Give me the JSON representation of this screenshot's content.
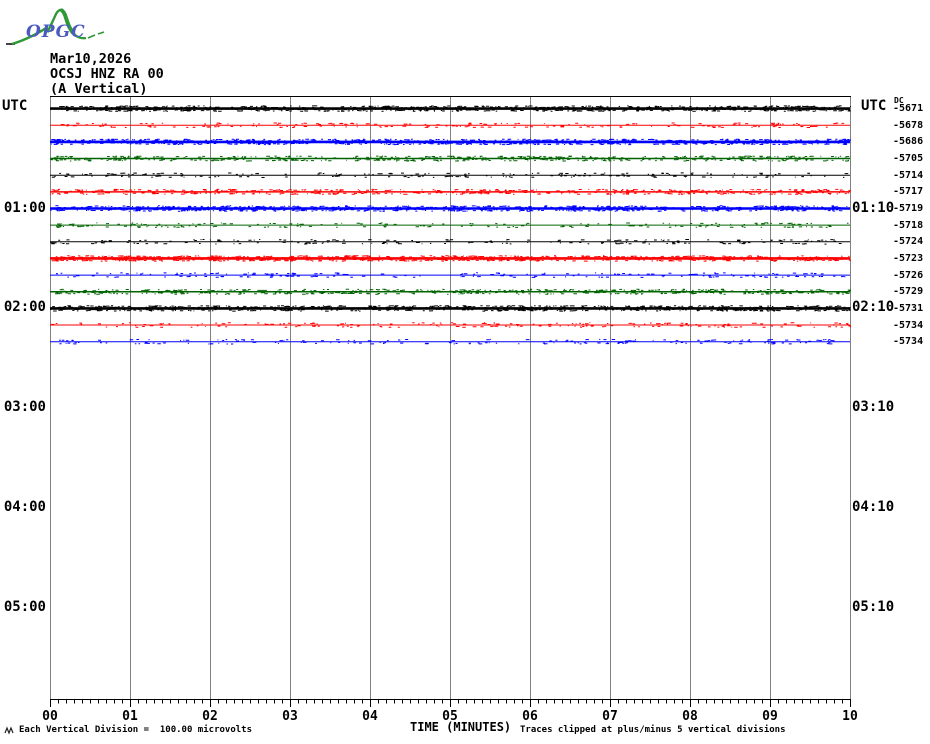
{
  "logo": {
    "text": "OPGC"
  },
  "header": {
    "date": "Mar10,2026",
    "station": "OCSJ HNZ RA 00",
    "component": "(A Vertical)"
  },
  "axis": {
    "left_title": "UTC",
    "right_title": "UTC"
  },
  "footer": {
    "scale_note": "Each Vertical Division =  100.00 microvolts",
    "xaxis_title": "TIME (MINUTES)",
    "clip_note": "Traces clipped at plus/minus 5 vertical divisions"
  },
  "chart_data": {
    "type": "line",
    "subtype": "helicorder-seismogram",
    "title": "OCSJ HNZ RA 00 (A Vertical) Mar10,2026",
    "xlabel": "TIME (MINUTES)",
    "x_range_minutes": [
      0,
      10
    ],
    "x_tick_labels": [
      "00",
      "01",
      "02",
      "03",
      "04",
      "05",
      "06",
      "07",
      "08",
      "09",
      "10"
    ],
    "x_minor_ticks_per_division": 10,
    "minutes_per_row": 10,
    "rows_per_hour": 6,
    "grid": "vertical-only",
    "dc_column_header": "DC",
    "left_time_labels": [
      {
        "label": "01:00",
        "row": 6
      },
      {
        "label": "02:00",
        "row": 12
      },
      {
        "label": "03:00",
        "row": 18
      },
      {
        "label": "04:00",
        "row": 24
      },
      {
        "label": "05:00",
        "row": 30
      }
    ],
    "right_time_labels": [
      {
        "label": "01:10",
        "row": 6
      },
      {
        "label": "02:10",
        "row": 12
      },
      {
        "label": "03:10",
        "row": 18
      },
      {
        "label": "04:10",
        "row": 24
      },
      {
        "label": "05:10",
        "row": 30
      }
    ],
    "traces": [
      {
        "start": "00:00",
        "color": "black",
        "weight": "thick",
        "dc_value": "-5671"
      },
      {
        "start": "00:10",
        "color": "red",
        "weight": "thin",
        "dc_value": "-5678"
      },
      {
        "start": "00:20",
        "color": "blue",
        "weight": "thick",
        "dc_value": "-5686"
      },
      {
        "start": "00:30",
        "color": "green",
        "weight": "medium",
        "dc_value": "-5705"
      },
      {
        "start": "00:40",
        "color": "black",
        "weight": "thin",
        "dc_value": "-5714"
      },
      {
        "start": "00:50",
        "color": "red",
        "weight": "medium",
        "dc_value": "-5717"
      },
      {
        "start": "01:00",
        "color": "blue",
        "weight": "thick",
        "dc_value": "-5719"
      },
      {
        "start": "01:10",
        "color": "green",
        "weight": "thin",
        "dc_value": "-5718"
      },
      {
        "start": "01:20",
        "color": "black",
        "weight": "thin",
        "dc_value": "-5724"
      },
      {
        "start": "01:30",
        "color": "red",
        "weight": "thick",
        "dc_value": "-5723"
      },
      {
        "start": "01:40",
        "color": "blue",
        "weight": "thin",
        "dc_value": "-5726"
      },
      {
        "start": "01:50",
        "color": "green",
        "weight": "medium",
        "dc_value": "-5729"
      },
      {
        "start": "02:00",
        "color": "black",
        "weight": "thick",
        "dc_value": "-5731"
      },
      {
        "start": "02:10",
        "color": "red",
        "weight": "thin",
        "dc_value": "-5734"
      },
      {
        "start": "02:20",
        "color": "blue",
        "weight": "thin",
        "dc_value": "-5734"
      }
    ],
    "colors": {
      "black": "#000000",
      "red": "#ff0000",
      "blue": "#0000ff",
      "green": "#006400",
      "grid": "#808080",
      "frame": "#000000"
    }
  }
}
